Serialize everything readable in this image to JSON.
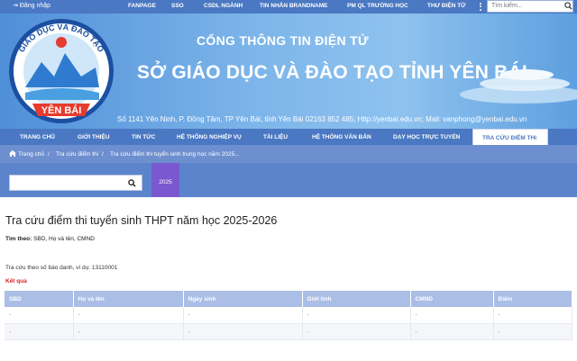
{
  "topbar": {
    "login": "Đăng nhập",
    "links": [
      "FANPAGE",
      "SSO",
      "CSDL NGÀNH",
      "TIN NHẮN BRANDNAME",
      "PM QL TRƯỜNG HỌC",
      "THƯ ĐIỆN TỬ"
    ],
    "search_placeholder": "Tìm kiếm..."
  },
  "banner": {
    "logo_top": "GIÁO DỤC VÀ ĐÀO TẠO",
    "logo_bottom": "YÊN BÁI",
    "title1": "CỔNG THÔNG TIN ĐIỆN TỬ",
    "title2": "SỞ GIÁO DỤC VÀ ĐÀO TẠO TỈNH YÊN BÁI",
    "contact": "Số 1141 Yên Ninh, P. Đồng Tâm, TP Yên Bái, tỉnh Yên Bái  02163 852 485; Http://yenbai.edu.vn; Mail: vanphong@yenbai.edu.vn"
  },
  "nav": [
    "TRANG CHỦ",
    "GIỚI THIỆU",
    "TIN TỨC",
    "HỆ THỐNG NGHIỆP VỤ",
    "TÀI LIỆU",
    "HỆ THỐNG VĂN BẢN",
    "DẠY HỌC TRỰC TUYẾN",
    "TRA CỨU ĐIỂM THI"
  ],
  "breadcrumb": [
    "Trang chủ",
    "Tra cứu điểm thi",
    "Tra cứu điểm thi tuyển sinh trung học năm 2025..."
  ],
  "filter": {
    "year": "2025"
  },
  "page": {
    "title": "Tra cứu điểm thi tuyển sinh THPT năm học 2025-2026",
    "search_by_label": "Tìm theo:",
    "search_by_value": "SBD, Họ và tên, CMND",
    "hint": "Tra cứu theo số báo danh, ví dụ: 13110001",
    "results_label": "Kết quả"
  },
  "table": {
    "headers": [
      "SBD",
      "Họ và tên",
      "Ngày sinh",
      "Giới tính",
      "CMND",
      "Điểm"
    ],
    "rows": [
      [
        "-",
        "-",
        "-",
        "-",
        "-",
        "-"
      ],
      [
        "-",
        "-",
        "-",
        "-",
        "-",
        "-"
      ]
    ]
  },
  "colors": {
    "primary": "#4a78c2",
    "accent": "#7a58d0",
    "alert": "#d22222"
  }
}
